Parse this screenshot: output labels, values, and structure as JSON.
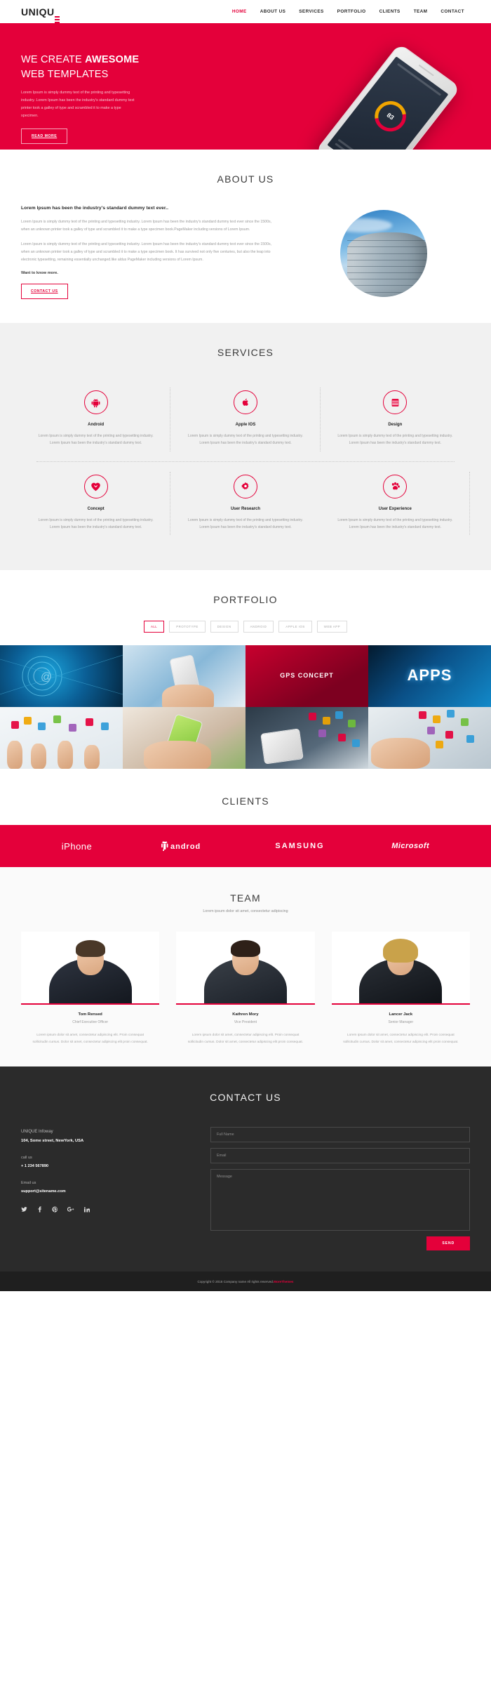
{
  "brand": {
    "name_part1": "UNIQU",
    "name_part2": "E"
  },
  "nav": {
    "items": [
      {
        "label": "HOME",
        "active": true
      },
      {
        "label": "ABOUT US",
        "active": false
      },
      {
        "label": "SERVICES",
        "active": false
      },
      {
        "label": "PORTFOLIO",
        "active": false
      },
      {
        "label": "CLIENTS",
        "active": false
      },
      {
        "label": "TEAM",
        "active": false
      },
      {
        "label": "CONTACT",
        "active": false
      }
    ]
  },
  "hero": {
    "title_line1_normal": "WE CREATE ",
    "title_line1_bold": "AWESOME",
    "title_line2": "WEB TEMPLATES",
    "paragraph": "Lorem Ipsum is simply dummy text of the printing and typesetting industry. Lorem Ipsum has been the industry's standard dummy text printer took a galley of type and scrambled it to make a type specimen.",
    "button": "READ MORE",
    "phone_ring_value": "83",
    "background_color": "#e4003a"
  },
  "about": {
    "title": "ABOUT US",
    "heading": "Lorem Ipsum has been the industry's standard dummy text ever..",
    "paragraph1": "Lorem Ipsum is simply dummy text of the printing and typesetting industry. Lorem Ipsum has been the industry's standard dummy text ever since the 1500s, when an unknown printer took a galley of type and scrambled it to make a type specimen book.PageMaker including versions of Lorem Ipsum.",
    "paragraph2": "Lorem Ipsum is simply dummy text of the printing and typesetting industry. Lorem Ipsum has been the industry's standard dummy text ever since the 1500s, when an unknown printer took a galley of type and scrambled it to make a type specimen book. It has survived not only five centuries, but also the leap into electronic typesetting, remaining essentially unchanged.like aldus PageMaker including versions of Lorem Ipsum.",
    "know_more": "Want to know more.",
    "button": "CONTACT US"
  },
  "services": {
    "title": "SERVICES",
    "items": [
      {
        "icon": "android-icon",
        "glyph": "⚙",
        "name": "Android",
        "text": "Lorem Ipsum is simply dummy text of the printing and typesetting industry. Lorem Ipsum has been the industry's standard dummy text."
      },
      {
        "icon": "apple-icon",
        "glyph": "",
        "name": "Apple IOS",
        "text": "Lorem Ipsum is simply dummy text of the printing and typesetting industry. Lorem Ipsum has been the industry's standard dummy text."
      },
      {
        "icon": "design-icon",
        "glyph": "▤",
        "name": "Design",
        "text": "Lorem Ipsum is simply dummy text of the printing and typesetting industry. Lorem Ipsum has been the industry's standard dummy text."
      },
      {
        "icon": "heart-icon",
        "glyph": "♥",
        "name": "Concept",
        "text": "Lorem Ipsum is simply dummy text of the printing and typesetting industry. Lorem Ipsum has been the industry's standard dummy text."
      },
      {
        "icon": "gear-icon",
        "glyph": "❁",
        "name": "User Research",
        "text": "Lorem Ipsum is simply dummy text of the printing and typesetting industry. Lorem Ipsum has been the industry's standard dummy text."
      },
      {
        "icon": "paw-icon",
        "glyph": "✿",
        "name": "User Experience",
        "text": "Lorem Ipsum is simply dummy text of the printing and typesetting industry. Lorem Ipsum has been the industry's standard dummy text."
      }
    ]
  },
  "portfolio": {
    "title": "PORTFOLIO",
    "filters": [
      {
        "label": "ALL",
        "active": true
      },
      {
        "label": "PROTOTYPE",
        "active": false
      },
      {
        "label": "DESIGN",
        "active": false
      },
      {
        "label": "ANDROID",
        "active": false
      },
      {
        "label": "APPLE IOS",
        "active": false
      },
      {
        "label": "WEB APP",
        "active": false
      }
    ],
    "items": [
      {
        "name": "portfolio-item-network",
        "caption": ""
      },
      {
        "name": "portfolio-item-cloud-phone",
        "caption": ""
      },
      {
        "name": "portfolio-item-gps",
        "caption": "GPS CONCEPT"
      },
      {
        "name": "portfolio-item-apps",
        "caption": "APPS"
      },
      {
        "name": "portfolio-item-hands-phones",
        "caption": ""
      },
      {
        "name": "portfolio-item-green-phone",
        "caption": ""
      },
      {
        "name": "portfolio-item-tablet-icons",
        "caption": ""
      },
      {
        "name": "portfolio-item-app-icons",
        "caption": ""
      }
    ]
  },
  "clients": {
    "title": "CLIENTS",
    "logos": [
      {
        "name": "iphone-logo",
        "label": "iPhone"
      },
      {
        "name": "android-logo",
        "label": "androd"
      },
      {
        "name": "samsung-logo",
        "label": "SAMSUNG"
      },
      {
        "name": "microsoft-logo",
        "label": "Microsoft"
      }
    ],
    "bar_color": "#e4003a"
  },
  "team": {
    "title": "TEAM",
    "subtitle": "Lorem ipsum dolor sit amet, consectetur adipiscing",
    "members": [
      {
        "name": "Tom Rensed",
        "role": "Chief Executive Officer",
        "bio": "Lorem ipsum dolor sit amet, consectetur adipiscing elit. Proin consequat sollicitudin cursus. Dolor sit amet, consectetur adipiscing elit proin consequat."
      },
      {
        "name": "Kathren Mory",
        "role": "Vice President",
        "bio": "Lorem ipsum dolor sit amet, consectetur adipiscing elit. Proin consequat sollicitudin cursus. Dolor sit amet, consectetur adipiscing elit proin consequat."
      },
      {
        "name": "Lancer Jack",
        "role": "Senior Manager",
        "bio": "Lorem ipsum dolor sit amet, consectetur adipiscing elit. Proin consequat sollicitudin cursus. Dolor sit amet, consectetur adipiscing elit proin consequat."
      }
    ]
  },
  "contact": {
    "title": "CONTACT US",
    "company": "UNIQUE Infoway",
    "address": "104, Some street, NewYork, USA",
    "call_label": "call us",
    "phone": "+ 1 234 567890",
    "email_label": "Email us",
    "email": "support@sitename.com",
    "socials": [
      {
        "name": "twitter-icon",
        "glyph": "✉"
      },
      {
        "name": "facebook-icon",
        "glyph": "f"
      },
      {
        "name": "pinterest-icon",
        "glyph": "Ⓟ"
      },
      {
        "name": "google-plus-icon",
        "glyph": "g"
      },
      {
        "name": "linkedin-icon",
        "glyph": "in"
      }
    ],
    "form": {
      "name_placeholder": "Full Name",
      "name_value": "",
      "email_placeholder": "Email",
      "email_value": "",
      "message_placeholder": "Message",
      "message_value": "",
      "send_label": "SEND"
    }
  },
  "footer": {
    "copyright": "Copyright © 2016 Company name All rights reserved.",
    "credit": "MoreThemes"
  }
}
